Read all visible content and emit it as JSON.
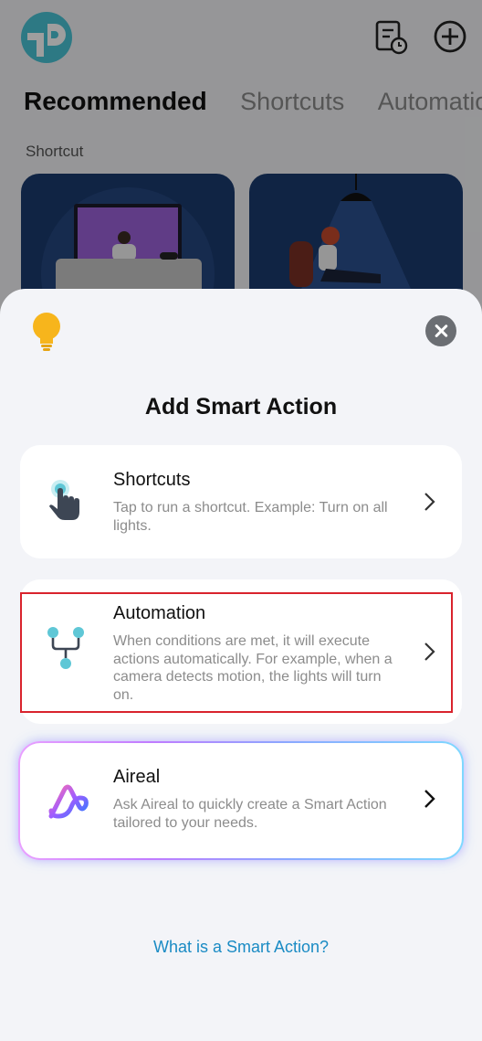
{
  "header": {
    "logo_icon": "tp-link-logo-icon",
    "log_icon": "activity-log-icon",
    "add_icon": "add-circle-icon"
  },
  "tabs": [
    {
      "label": "Recommended",
      "active": true
    },
    {
      "label": "Shortcuts",
      "active": false
    },
    {
      "label": "Automatio",
      "active": false
    }
  ],
  "section_label": "Shortcut",
  "sheet": {
    "bulb_icon": "lightbulb-icon",
    "close_icon": "close-icon",
    "title": "Add Smart Action",
    "options": [
      {
        "icon": "tap-hand-icon",
        "title": "Shortcuts",
        "description": "Tap to run a shortcut. Example: Turn on all lights."
      },
      {
        "icon": "automation-flow-icon",
        "title": "Automation",
        "description": "When conditions are met, it will execute actions automatically. For example, when a camera detects motion, the lights will turn on."
      },
      {
        "icon": "aireal-logo-icon",
        "title": "Aireal",
        "description": "Ask Aireal to quickly create a Smart Action tailored to your needs."
      }
    ],
    "help_link": "What is a Smart Action?"
  },
  "colors": {
    "accent_teal": "#27a0b5",
    "link_blue": "#1a8bc4",
    "highlight_red": "#d9232d"
  }
}
